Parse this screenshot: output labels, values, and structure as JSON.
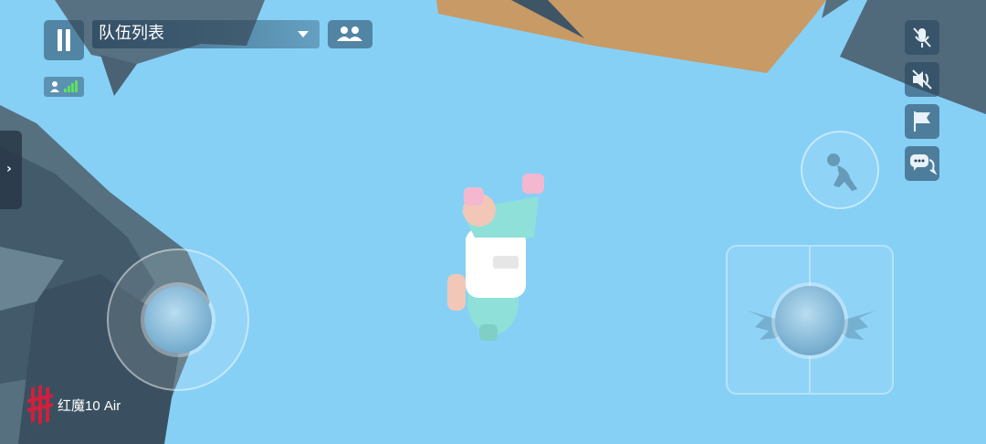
{
  "hud": {
    "team_dropdown_label": "队伍列表"
  },
  "icons": {
    "pause": "pause-icon",
    "team": "team-icon",
    "signal": "signal-icon",
    "expand": "chevron-right-icon",
    "mute_mic": "mic-muted-icon",
    "mute_speaker": "speaker-muted-icon",
    "flag": "flag-icon",
    "chat": "chat-icon",
    "action": "jump-figure-icon",
    "grab": "grab-hands-icon"
  },
  "watermark": {
    "text": "红魔10 Air"
  },
  "colors": {
    "sky": "#86d0f6",
    "rock": "#4a6273",
    "crate": "#c89a66",
    "hud_dark": "#28465f"
  }
}
